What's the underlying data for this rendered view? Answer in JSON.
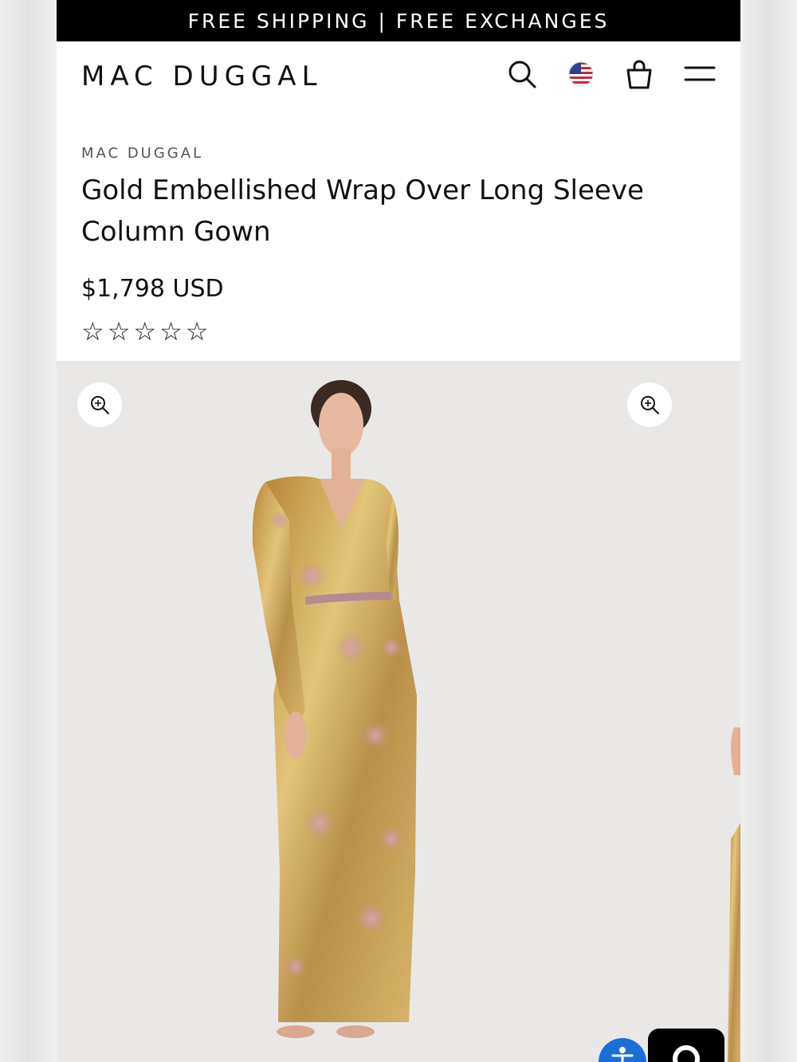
{
  "announcement": "FREE SHIPPING | FREE EXCHANGES",
  "header": {
    "logo": "MAC DUGGAL",
    "icons": [
      "search-icon",
      "us-flag-icon",
      "shopping-bag-icon",
      "menu-icon"
    ]
  },
  "product": {
    "brand": "MAC DUGGAL",
    "title": "Gold Embellished Wrap Over Long Sleeve Column Gown",
    "price": "$1,798 USD",
    "rating": 0,
    "rating_max": 5
  },
  "gallery": {
    "image": "gold-sequin-gown-photo",
    "icons": [
      "zoom-in-icon",
      "zoom-in-icon",
      "accessibility-icon",
      "chat-icon"
    ]
  },
  "colors": {
    "announce_bg": "#000000",
    "gallery_bg": "#e9e8e6",
    "gown_gold": "#c9a24e",
    "accessibility_blue": "#1a6ed8"
  }
}
